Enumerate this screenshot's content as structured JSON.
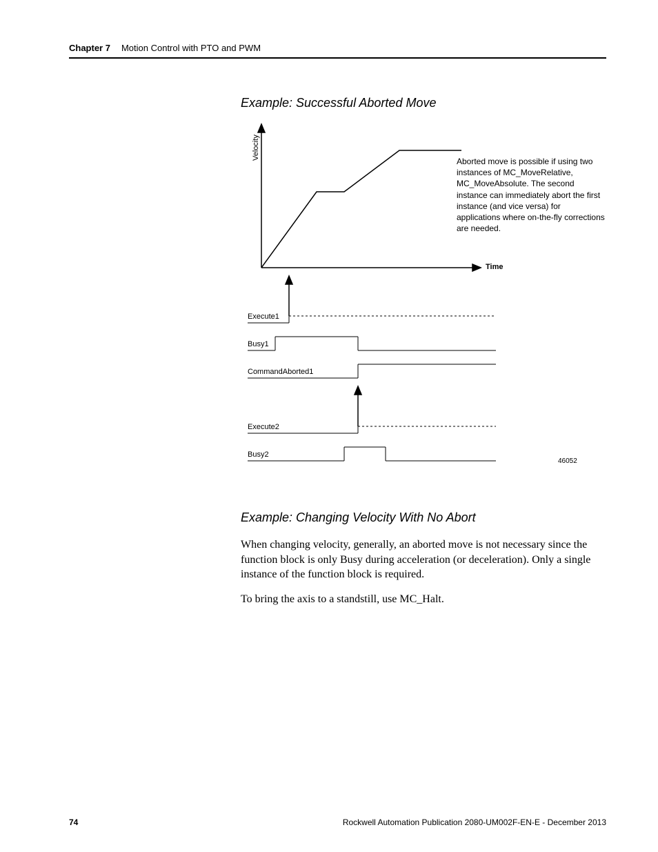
{
  "header": {
    "chapter_label": "Chapter 7",
    "chapter_title": "Motion Control with PTO and PWM"
  },
  "example1": {
    "heading": "Example: Successful Aborted Move",
    "y_axis_label": "Velocity",
    "x_axis_label": "Time",
    "annotation": "Aborted move is possible if using two instances of MC_MoveRelative, MC_MoveAbsolute. The second instance can immediately abort the first instance (and vice versa) for applications where on-the-fly corrections are needed.",
    "signals": {
      "execute1": "Execute1",
      "busy1": "Busy1",
      "command_aborted1": "CommandAborted1",
      "execute2": "Execute2",
      "busy2": "Busy2"
    },
    "figure_number": "46052"
  },
  "example2": {
    "heading": "Example: Changing Velocity With No Abort",
    "para1": "When changing velocity, generally, an aborted move is not necessary since the function block is only Busy during acceleration (or deceleration). Only a single instance of the function block is required.",
    "para2": "To bring the axis to a standstill, use MC_Halt."
  },
  "footer": {
    "page": "74",
    "publication": "Rockwell Automation Publication 2080-UM002F-EN-E - December 2013"
  },
  "chart_data": {
    "type": "line",
    "title": "Successful Aborted Move — velocity vs time with execute/busy/aborted signals",
    "xlabel": "Time",
    "ylabel": "Velocity",
    "series": [
      {
        "name": "Velocity",
        "points": [
          {
            "x": 0,
            "y": 0
          },
          {
            "x": 80,
            "y": 110
          },
          {
            "x": 120,
            "y": 110
          },
          {
            "x": 200,
            "y": 170
          },
          {
            "x": 290,
            "y": 170
          }
        ]
      },
      {
        "name": "Execute1",
        "type": "digital",
        "points": [
          {
            "x": 0,
            "y": 0
          },
          {
            "x": 40,
            "y": 0
          },
          {
            "x": 40,
            "y": 1
          },
          {
            "x": 340,
            "y": 1
          }
        ],
        "dashed_after_x": 40
      },
      {
        "name": "Busy1",
        "type": "digital",
        "points": [
          {
            "x": 0,
            "y": 0
          },
          {
            "x": 40,
            "y": 0
          },
          {
            "x": 40,
            "y": 1
          },
          {
            "x": 140,
            "y": 1
          },
          {
            "x": 140,
            "y": 0
          },
          {
            "x": 340,
            "y": 0
          }
        ]
      },
      {
        "name": "CommandAborted1",
        "type": "digital",
        "points": [
          {
            "x": 0,
            "y": 0
          },
          {
            "x": 140,
            "y": 0
          },
          {
            "x": 140,
            "y": 1
          },
          {
            "x": 340,
            "y": 1
          }
        ]
      },
      {
        "name": "Execute2",
        "type": "digital",
        "points": [
          {
            "x": 0,
            "y": 0
          },
          {
            "x": 140,
            "y": 0
          },
          {
            "x": 140,
            "y": 1
          },
          {
            "x": 340,
            "y": 1
          }
        ],
        "dashed_after_x": 140
      },
      {
        "name": "Busy2",
        "type": "digital",
        "points": [
          {
            "x": 0,
            "y": 0
          },
          {
            "x": 140,
            "y": 0
          },
          {
            "x": 140,
            "y": 1
          },
          {
            "x": 180,
            "y": 1
          },
          {
            "x": 180,
            "y": 0
          },
          {
            "x": 340,
            "y": 0
          }
        ]
      }
    ],
    "event_arrows": [
      {
        "name": "Execute1 rising edge",
        "x": 40
      },
      {
        "name": "Execute2 rising edge",
        "x": 140
      }
    ]
  }
}
